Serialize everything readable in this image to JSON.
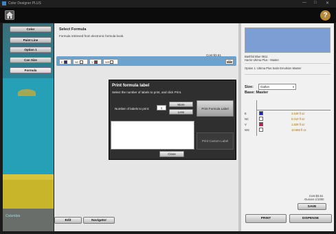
{
  "titlebar": {
    "title": "Color Designer PLUS",
    "minimize": "—",
    "maximize": "□",
    "close": "✕"
  },
  "topbar": {
    "home_icon": "home-icon",
    "help": "?"
  },
  "nav": {
    "items": [
      {
        "label": "Color"
      },
      {
        "label": "Paint Line"
      },
      {
        "label": "Option 1"
      },
      {
        "label": "Can Size"
      },
      {
        "label": "Formula"
      }
    ]
  },
  "room": {
    "logo": "Columbia"
  },
  "formula": {
    "title": "Select Formula",
    "subtitle": "Formula retrieved from electronic formula book.",
    "cost": "Cost $3.51",
    "chips": [
      {
        "code": "E",
        "color": "#1c2aa8"
      },
      {
        "code": "NC",
        "color": "#ffffff"
      },
      {
        "code": "V",
        "color": "#b0245a"
      },
      {
        "code": "WS",
        "color": "#ffffff"
      }
    ]
  },
  "bottom": {
    "edit": "Edit",
    "navigator": "Navigator",
    "print": "PRINT",
    "dispense": "DISPENSE",
    "save": "SAVE"
  },
  "right": {
    "swatch_color": "#7d9ed4",
    "color_name": "Bashful Blue 0811",
    "color_source": "Harris Ultima Plus - Master",
    "product": "Option 1: Ultima Plus Satin Emulsion Master",
    "size_label": "Size:",
    "size_value": "Gallon",
    "base_label": "Base: Master",
    "rows": [
      {
        "code": "E",
        "color": "#1c2aa8",
        "amount": "3.549 fl oz"
      },
      {
        "code": "NC",
        "color": "#ffffff",
        "amount": "0.010 fl oz"
      },
      {
        "code": "V",
        "color": "#b0245a",
        "amount": "1.829 fl oz"
      },
      {
        "code": "WS",
        "color": "#ffffff",
        "amount": "10.688 fl oz"
      }
    ],
    "cost": "Cost $3.51",
    "ounces": "Ounces 1/1000"
  },
  "modal": {
    "title": "Print formula label",
    "instruction": "Select the number of labels to print, and click Print.",
    "num_label": "Number of labels to print:",
    "num_value": "1",
    "more": "More",
    "less": "Less",
    "print_formula": "Print Formula Label",
    "print_custom": "Print Custom Label",
    "close": "Close",
    "custom_text": ""
  }
}
